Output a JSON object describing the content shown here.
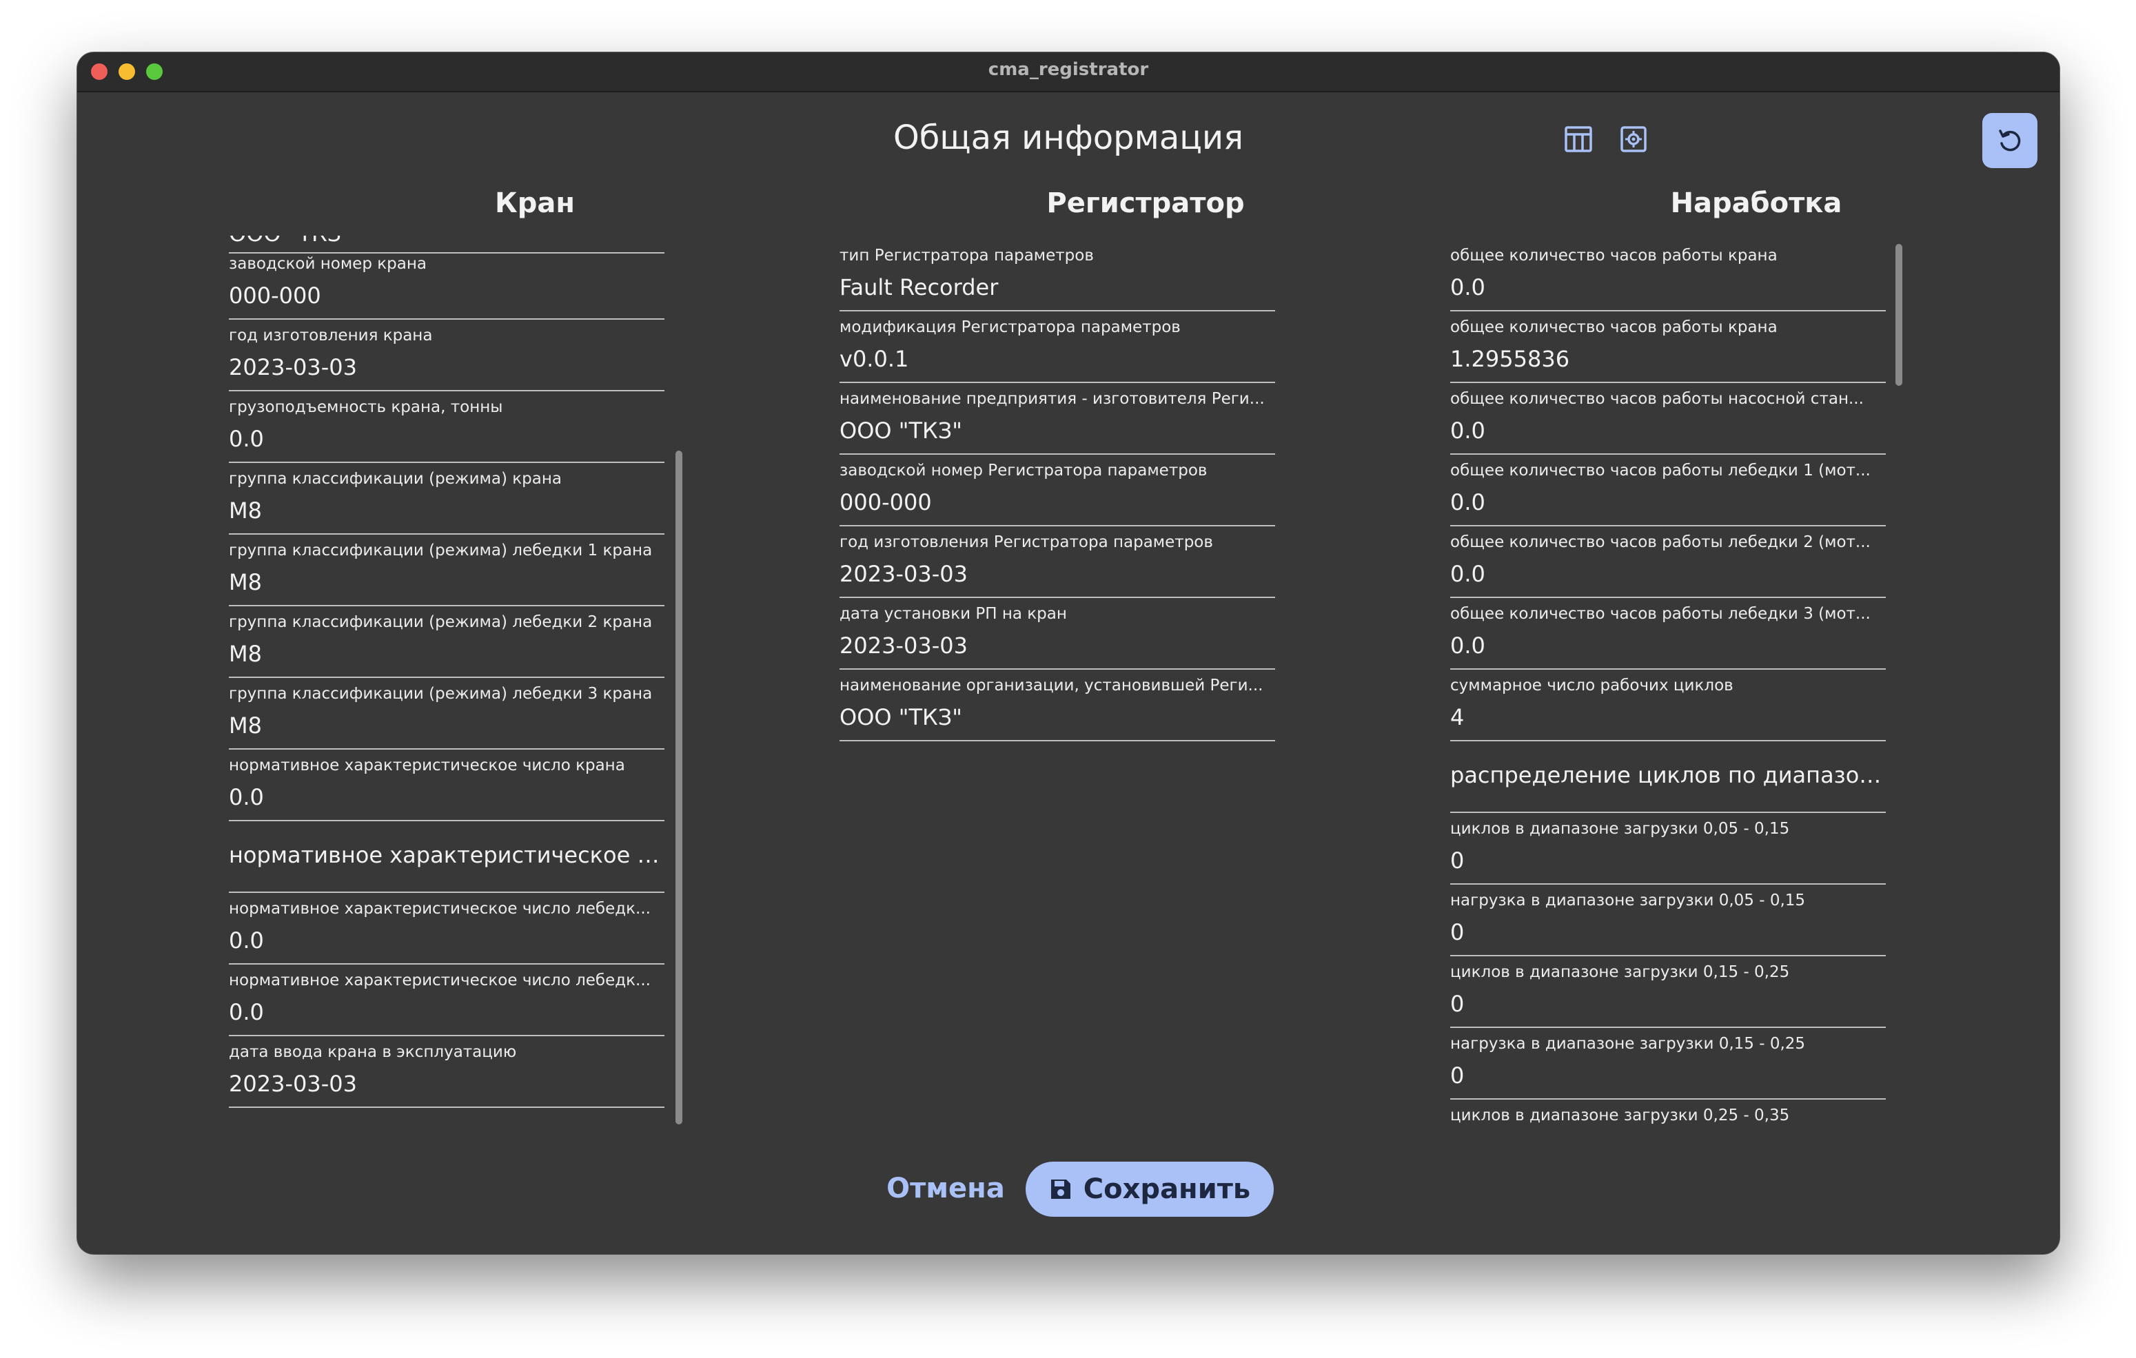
{
  "window": {
    "title": "cma_registrator"
  },
  "header": {
    "title": "Общая информация",
    "icons": [
      "table-icon",
      "settings-icon"
    ],
    "refresh_icon": "refresh-icon"
  },
  "colors": {
    "accent": "#a9c1f6",
    "background": "#383838",
    "titlebar": "#2c2c2c"
  },
  "columns": {
    "crane": {
      "title": "Кран",
      "partial_top_value": "ООО \"ТКЗ\"",
      "fields": [
        {
          "label": "заводской номер крана",
          "value": "000-000"
        },
        {
          "label": "год изготовления крана",
          "value": "2023-03-03"
        },
        {
          "label": "грузоподъемность крана, тонны",
          "value": "0.0"
        },
        {
          "label": "группа классификации (режима) крана",
          "value": "M8"
        },
        {
          "label": "группа классификации (режима) лебедки 1 крана",
          "value": "M8"
        },
        {
          "label": "группа классификации (режима) лебедки 2 крана",
          "value": "M8"
        },
        {
          "label": "группа классификации (режима) лебедки 3 крана",
          "value": "M8"
        },
        {
          "label": "нормативное характеристическое число крана",
          "value": "0.0"
        },
        {
          "label": "",
          "value": "нормативное характеристическое ч..."
        },
        {
          "label": "нормативное характеристическое число лебедк...",
          "value": "0.0"
        },
        {
          "label": "нормативное характеристическое число лебедк...",
          "value": "0.0"
        },
        {
          "label": "дата ввода крана в эксплуатацию",
          "value": "2023-03-03"
        }
      ]
    },
    "registrator": {
      "title": "Регистратор",
      "fields": [
        {
          "label": "тип Регистратора параметров",
          "value": "Fault Recorder"
        },
        {
          "label": "модификация Регистратора параметров",
          "value": "v0.0.1"
        },
        {
          "label": "наименование предприятия - изготовителя Реги...",
          "value": "ООО \"ТКЗ\""
        },
        {
          "label": "заводской номер Регистратора параметров",
          "value": "000-000"
        },
        {
          "label": "год изготовления Регистратора параметров",
          "value": "2023-03-03"
        },
        {
          "label": "дата установки РП на кран",
          "value": "2023-03-03"
        },
        {
          "label": "наименование организации, установившей Реги...",
          "value": "ООО \"ТКЗ\""
        }
      ]
    },
    "runtime": {
      "title": "Наработка",
      "fields": [
        {
          "label": "общее количество часов работы крана",
          "value": "0.0"
        },
        {
          "label": "общее количество часов работы крана",
          "value": "1.2955836"
        },
        {
          "label": "общее количество часов работы насосной стан...",
          "value": "0.0"
        },
        {
          "label": "общее количество часов работы лебедки 1 (мот...",
          "value": "0.0"
        },
        {
          "label": "общее количество часов работы лебедки 2 (мот...",
          "value": "0.0"
        },
        {
          "label": "общее количество часов работы лебедки 3 (мот...",
          "value": "0.0"
        },
        {
          "label": "суммарное число рабочих циклов",
          "value": "4"
        },
        {
          "label": "",
          "value": "распределение циклов по диапазон..."
        },
        {
          "label": "циклов в диапазоне загрузки 0,05 - 0,15",
          "value": "0"
        },
        {
          "label": "нагрузка в диапазоне загрузки 0,05 - 0,15",
          "value": "0"
        },
        {
          "label": "циклов в диапазоне загрузки 0,15 - 0,25",
          "value": "0"
        },
        {
          "label": "нагрузка в диапазоне загрузки 0,15 - 0,25",
          "value": "0"
        },
        {
          "label": "циклов в диапазоне загрузки 0,25 - 0,35",
          "value": ""
        }
      ]
    }
  },
  "footer": {
    "cancel_label": "Отмена",
    "save_label": "Сохранить",
    "save_icon": "save-icon"
  }
}
